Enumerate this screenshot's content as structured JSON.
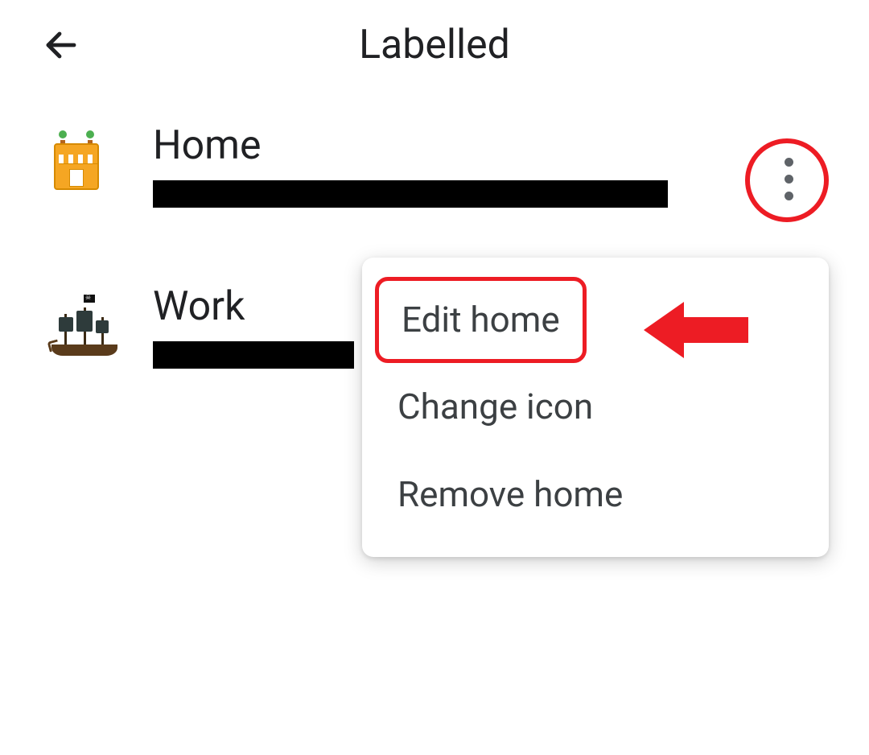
{
  "header": {
    "title": "Labelled"
  },
  "rows": {
    "home": {
      "label": "Home",
      "icon_name": "home-building-icon",
      "address_redacted": true
    },
    "work": {
      "label": "Work",
      "icon_name": "pirate-ship-icon",
      "address_redacted": true
    }
  },
  "menu": {
    "items": [
      {
        "label": "Edit home",
        "highlight": true
      },
      {
        "label": "Change icon"
      },
      {
        "label": "Remove home"
      }
    ]
  },
  "annotations": {
    "circle_more_button": true,
    "arrow_to_edit_home": true
  }
}
